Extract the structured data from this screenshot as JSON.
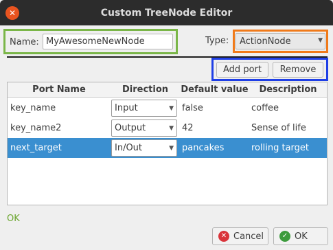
{
  "window": {
    "title": "Custom TreeNode Editor"
  },
  "name": {
    "label": "Name:",
    "value": "MyAwesomeNewNode"
  },
  "type": {
    "label": "Type:",
    "value": "ActionNode"
  },
  "buttons": {
    "add": "Add port",
    "remove": "Remove"
  },
  "table": {
    "headers": [
      "Port Name",
      "Direction",
      "Default value",
      "Description"
    ],
    "rows": [
      {
        "port": "key_name",
        "direction": "Input",
        "default": "false",
        "description": "coffee"
      },
      {
        "port": "key_name2",
        "direction": "Output",
        "default": "42",
        "description": "Sense of life"
      },
      {
        "port": "next_target",
        "direction": "In/Out",
        "default": "pancakes",
        "description": "rolling target"
      }
    ]
  },
  "status": "OK",
  "footer": {
    "cancel": "Cancel",
    "ok": "OK"
  },
  "colors": {
    "name_highlight": "#7ab648",
    "type_highlight": "#f07a1a",
    "buttons_highlight": "#1f3fe6",
    "selection": "#3a8fd0"
  }
}
